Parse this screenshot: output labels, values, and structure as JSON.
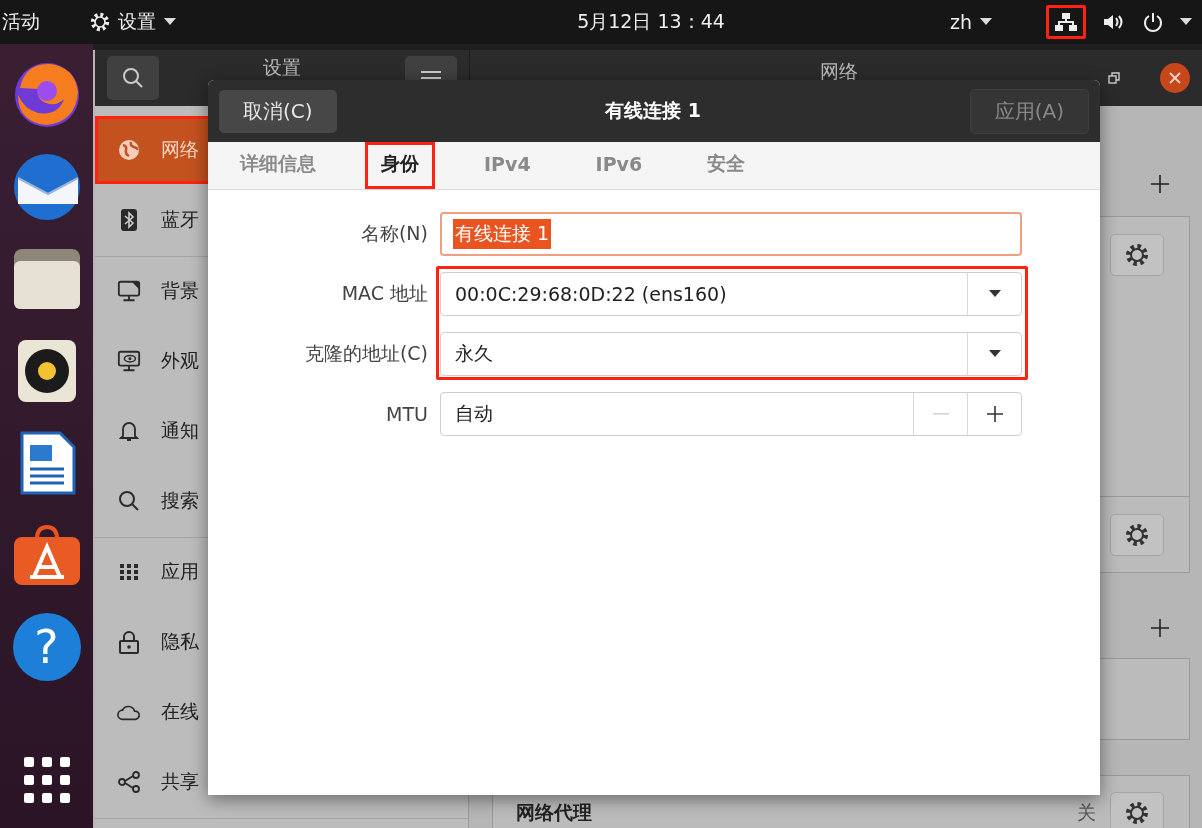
{
  "top_bar": {
    "activities": "活动",
    "app_menu": "设置",
    "clock": "5月12日 13：44",
    "input_method": "zh",
    "network_highlighted": true
  },
  "dock": {
    "help_label": "?"
  },
  "settings": {
    "sidebar_title": "设置",
    "panel_title": "网络",
    "sidebar": [
      {
        "label": "网络",
        "selected": true,
        "highlighted": true
      },
      {
        "label": "蓝牙",
        "selected": false,
        "highlighted": false
      },
      {
        "label": "背景",
        "selected": false,
        "highlighted": false
      },
      {
        "label": "外观",
        "selected": false,
        "highlighted": false
      },
      {
        "label": "通知",
        "selected": false,
        "highlighted": false
      },
      {
        "label": "搜索",
        "selected": false,
        "highlighted": false
      },
      {
        "label": "应用",
        "selected": false,
        "highlighted": false
      },
      {
        "label": "隐私",
        "selected": false,
        "highlighted": false
      },
      {
        "label": "在线",
        "selected": false,
        "highlighted": false
      },
      {
        "label": "共享",
        "selected": false,
        "highlighted": false
      }
    ],
    "proxy": {
      "label": "网络代理",
      "status": "关"
    }
  },
  "dialog": {
    "cancel": "取消(C)",
    "title": "有线连接 1",
    "apply": "应用(A)",
    "apply_disabled": true,
    "tabs": [
      {
        "label": "详细信息",
        "selected": false,
        "highlighted": false
      },
      {
        "label": "身份",
        "selected": true,
        "highlighted": true
      },
      {
        "label": "IPv4",
        "selected": false,
        "highlighted": false
      },
      {
        "label": "IPv6",
        "selected": false,
        "highlighted": false
      },
      {
        "label": "安全",
        "selected": false,
        "highlighted": false
      }
    ],
    "fields": [
      {
        "kind": "text",
        "label": "名称(N)",
        "value": "有线连接 1",
        "text_selected": true,
        "highlighted": false
      },
      {
        "kind": "dropdown",
        "label": "MAC 地址",
        "value": "00:0C:29:68:0D:22 (ens160)",
        "highlighted": true
      },
      {
        "kind": "dropdown",
        "label": "克隆的地址(C)",
        "value": "永久",
        "highlighted": true
      },
      {
        "kind": "spin",
        "label": "MTU",
        "value": "自动",
        "decrease_disabled": true,
        "highlighted": false
      }
    ]
  }
}
